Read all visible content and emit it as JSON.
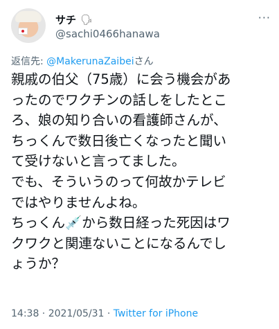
{
  "tweet": {
    "display_name": "サチ",
    "name_emoji": "🗣",
    "handle": "@sachi0466hanawa",
    "reply_prefix": "返信先: ",
    "reply_to": "@MakerunaZaibei",
    "reply_suffix": "さん",
    "lines": [
      "親戚の伯父（75歳）に会う機会があ",
      "ったのでワクチンの話しをしたとこ",
      "ろ、娘の知り合いの看護師さんが、",
      "ちっくんで数日後亡くなったと聞い",
      "て受けないと言ってました。",
      "でも、そういうのって何故かテレビ",
      "ではやりませんよね。",
      "ちっくん💉から数日経った死因はワ",
      "クワクと関連ないことになるんでし",
      "ょうか？"
    ],
    "time": "14:38",
    "separator1": " · ",
    "date": "2021/05/31",
    "separator2": " · ",
    "client": "Twitter for iPhone",
    "more_label": "···"
  }
}
